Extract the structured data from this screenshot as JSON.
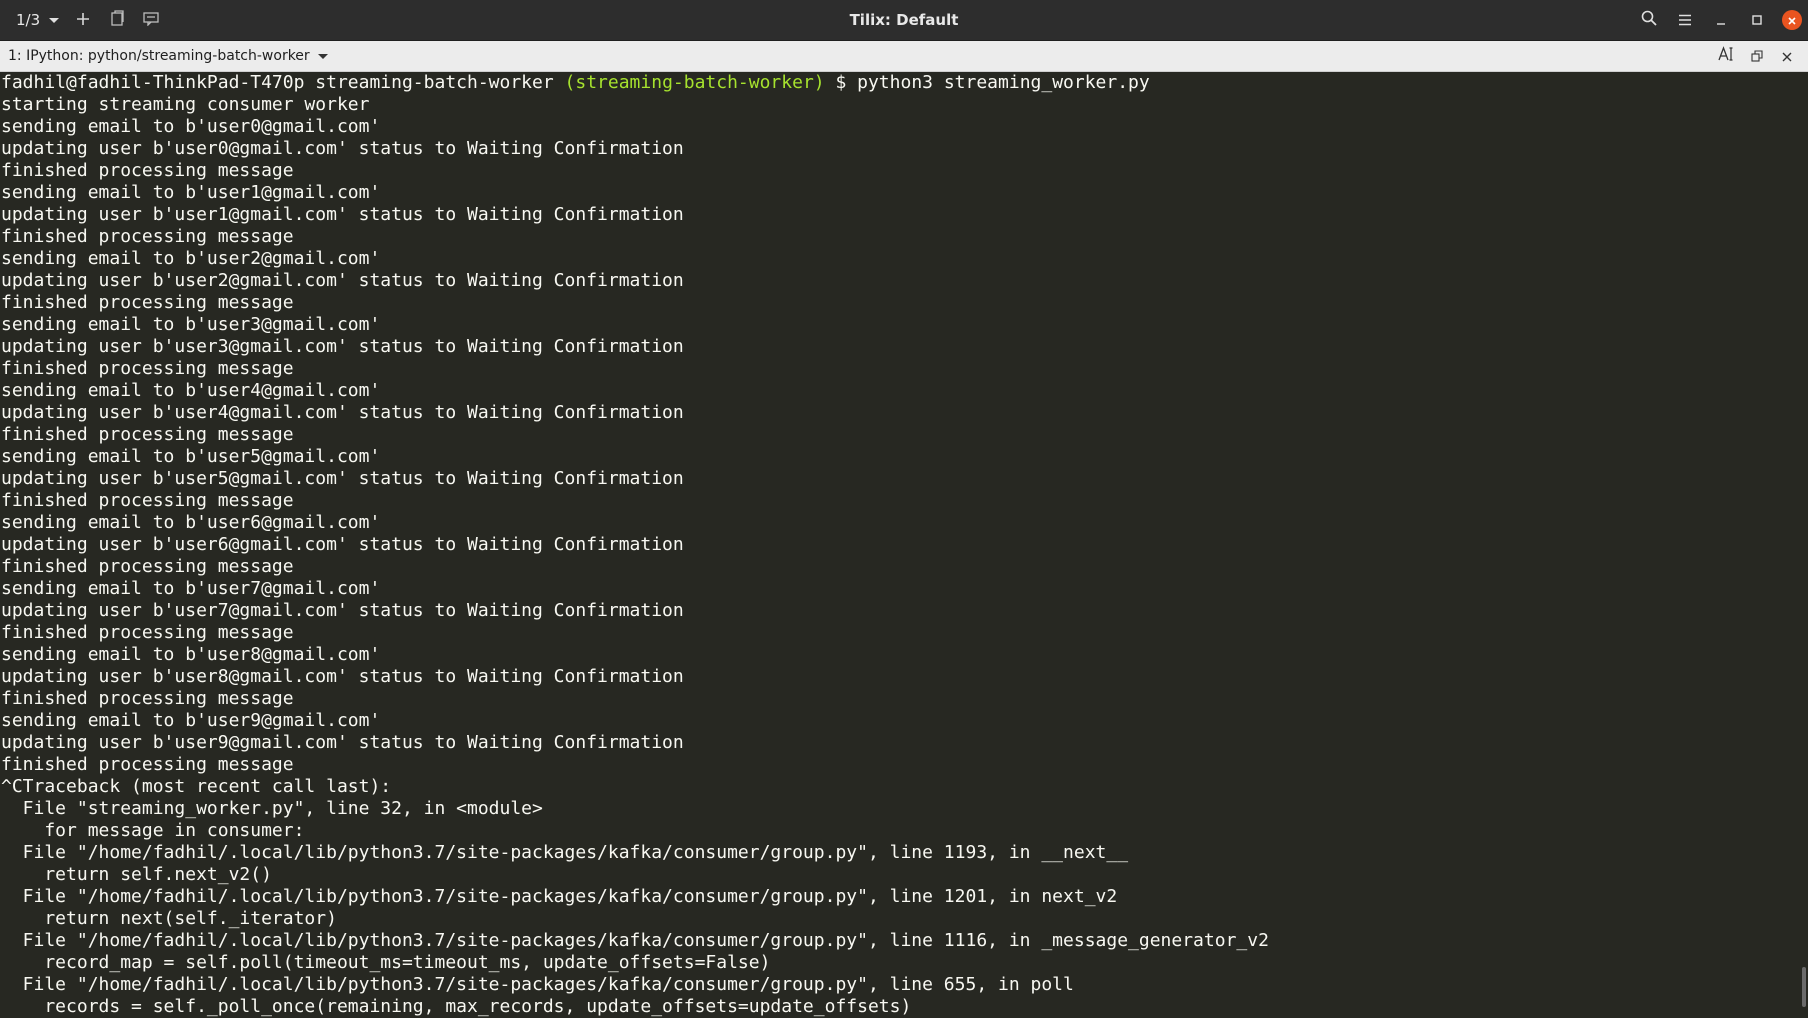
{
  "headerbar": {
    "session_counter": "1/3",
    "title": "Tilix: Default",
    "icons": {
      "dropdown": "chevron-down-icon",
      "add": "plus-icon",
      "sidebar": "sidebar-icon",
      "notify": "notification-icon",
      "search": "search-icon",
      "menu": "hamburger-menu-icon",
      "minimize": "minimize-icon",
      "maximize": "maximize-icon",
      "close": "close-icon"
    },
    "close_color": "#e95420"
  },
  "terminal_tab": {
    "title": "1: IPython: python/streaming-batch-worker",
    "icons": [
      "text-size-icon",
      "detach-icon",
      "close-icon"
    ]
  },
  "terminal": {
    "prompt": {
      "user_host_dir": "fadhil@fadhil-ThinkPad-T470p streaming-batch-worker ",
      "branch": "(streaming-batch-worker)",
      "command": " $ python3 streaming_worker.py"
    },
    "colors": {
      "background": "#272822",
      "foreground": "#f8f8f2",
      "branch": "#a6e22e"
    },
    "lines": [
      "starting streaming consumer worker",
      "sending email to b'user0@gmail.com'",
      "updating user b'user0@gmail.com' status to Waiting Confirmation",
      "finished processing message",
      "sending email to b'user1@gmail.com'",
      "updating user b'user1@gmail.com' status to Waiting Confirmation",
      "finished processing message",
      "sending email to b'user2@gmail.com'",
      "updating user b'user2@gmail.com' status to Waiting Confirmation",
      "finished processing message",
      "sending email to b'user3@gmail.com'",
      "updating user b'user3@gmail.com' status to Waiting Confirmation",
      "finished processing message",
      "sending email to b'user4@gmail.com'",
      "updating user b'user4@gmail.com' status to Waiting Confirmation",
      "finished processing message",
      "sending email to b'user5@gmail.com'",
      "updating user b'user5@gmail.com' status to Waiting Confirmation",
      "finished processing message",
      "sending email to b'user6@gmail.com'",
      "updating user b'user6@gmail.com' status to Waiting Confirmation",
      "finished processing message",
      "sending email to b'user7@gmail.com'",
      "updating user b'user7@gmail.com' status to Waiting Confirmation",
      "finished processing message",
      "sending email to b'user8@gmail.com'",
      "updating user b'user8@gmail.com' status to Waiting Confirmation",
      "finished processing message",
      "sending email to b'user9@gmail.com'",
      "updating user b'user9@gmail.com' status to Waiting Confirmation",
      "finished processing message",
      "^CTraceback (most recent call last):",
      "  File \"streaming_worker.py\", line 32, in <module>",
      "    for message in consumer:",
      "  File \"/home/fadhil/.local/lib/python3.7/site-packages/kafka/consumer/group.py\", line 1193, in __next__",
      "    return self.next_v2()",
      "  File \"/home/fadhil/.local/lib/python3.7/site-packages/kafka/consumer/group.py\", line 1201, in next_v2",
      "    return next(self._iterator)",
      "  File \"/home/fadhil/.local/lib/python3.7/site-packages/kafka/consumer/group.py\", line 1116, in _message_generator_v2",
      "    record_map = self.poll(timeout_ms=timeout_ms, update_offsets=False)",
      "  File \"/home/fadhil/.local/lib/python3.7/site-packages/kafka/consumer/group.py\", line 655, in poll",
      "    records = self._poll_once(remaining, max_records, update_offsets=update_offsets)"
    ]
  }
}
